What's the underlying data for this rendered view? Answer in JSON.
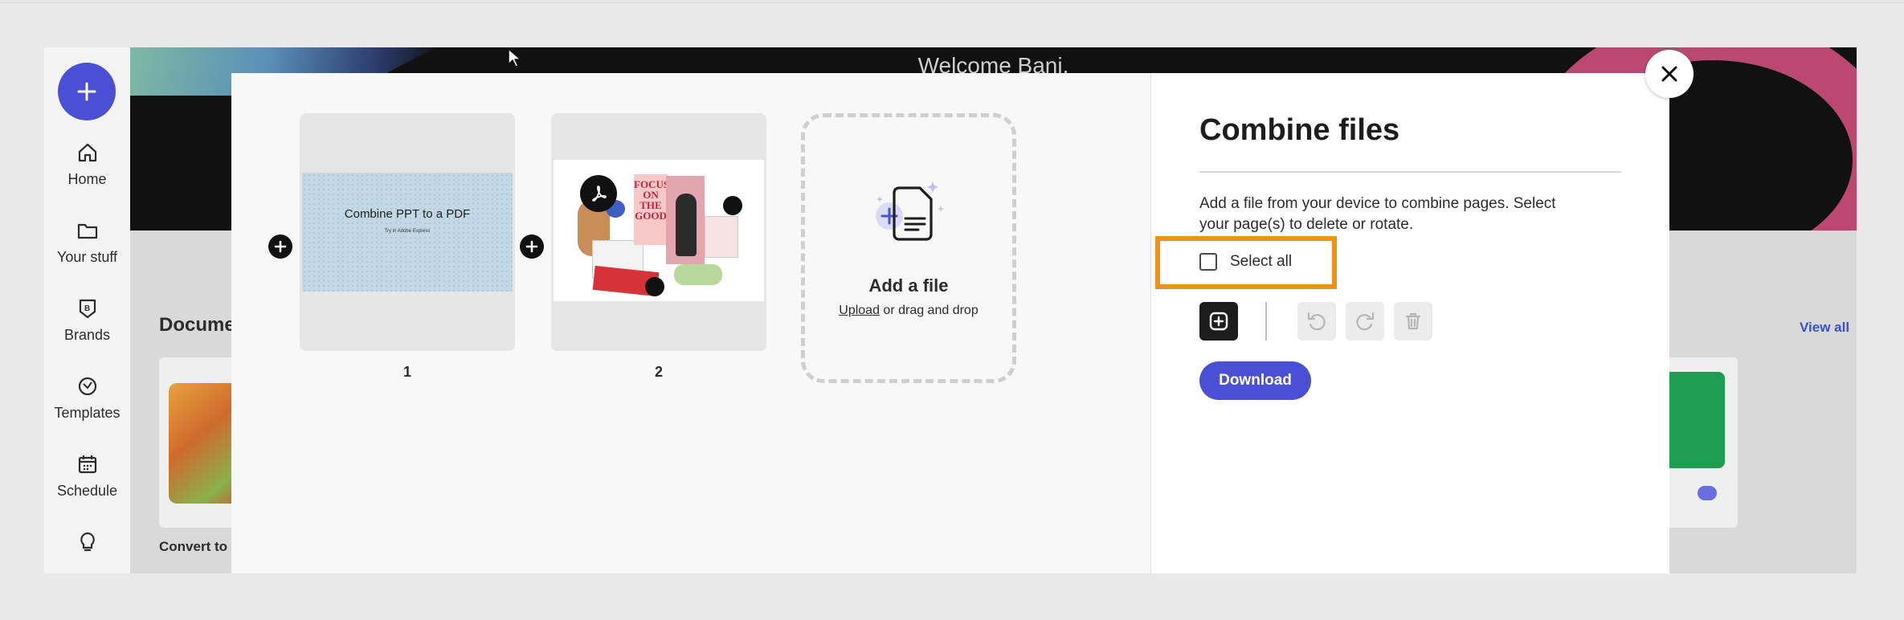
{
  "background": {
    "welcome": "Welcome Bani.",
    "documents_heading": "Docume",
    "view_all": "View all",
    "card_left_label": "Convert to F"
  },
  "rail": {
    "items": [
      {
        "label": "Home",
        "icon": "home-icon"
      },
      {
        "label": "Your stuff",
        "icon": "folder-icon"
      },
      {
        "label": "Brands",
        "icon": "brands-icon"
      },
      {
        "label": "Templates",
        "icon": "templates-icon"
      },
      {
        "label": "Schedule",
        "icon": "calendar-icon"
      },
      {
        "label": "",
        "icon": "lightbulb-icon"
      }
    ]
  },
  "modal": {
    "pages": [
      {
        "number": "1",
        "slide_title": "Combine PPT to a PDF",
        "slide_subtitle": "Try in Adobe Express"
      },
      {
        "number": "2",
        "collage_text": "FOCUS ON THE GOOD"
      }
    ],
    "add_file": {
      "title": "Add a file",
      "upload_link": "Upload",
      "rest": " or drag and drop"
    },
    "panel": {
      "title": "Combine files",
      "description": "Add a file from your device to combine pages. Select your page(s) to delete or rotate.",
      "select_all": "Select all",
      "download": "Download"
    }
  },
  "colors": {
    "accent": "#4b4fd6",
    "highlight": "#f0921a"
  }
}
